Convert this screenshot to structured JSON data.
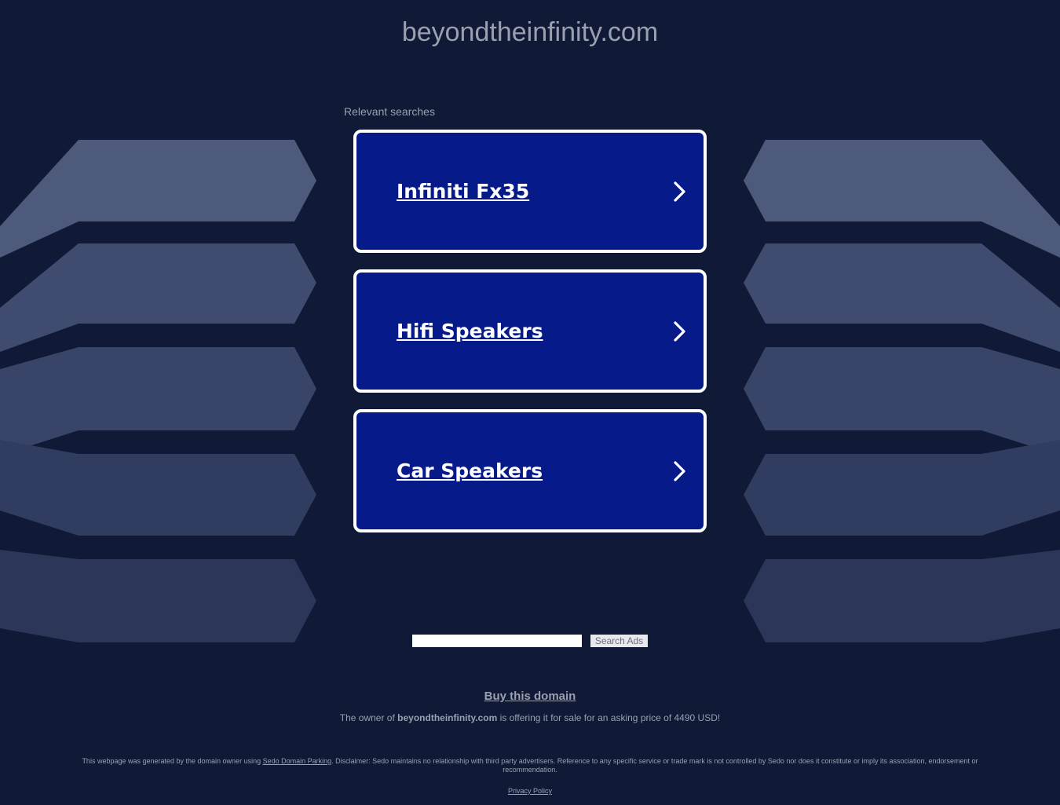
{
  "header": {
    "domain_title": "beyondtheinfinity.com"
  },
  "related": {
    "label": "Relevant searches",
    "items": [
      {
        "label": "Infiniti Fx35"
      },
      {
        "label": "Hifi Speakers"
      },
      {
        "label": "Car Speakers"
      }
    ]
  },
  "search": {
    "value": "",
    "button_label": "Search Ads"
  },
  "sale": {
    "buy_link": "Buy this domain",
    "offer_prefix": "The owner of ",
    "offer_domain": "beyondtheinfinity.com",
    "offer_suffix": " is offering it for sale for an asking price of 4490 USD!"
  },
  "footer": {
    "disclaimer_prefix": "This webpage was generated by the domain owner using ",
    "sedo_link": "Sedo Domain Parking",
    "disclaimer_suffix": ". Disclaimer: Sedo maintains no relationship with third party advertisers. Reference to any specific service or trade mark is not controlled by Sedo nor does it constitute or imply its association, endorsement or recommendation.",
    "privacy_link": "Privacy Policy"
  },
  "colors": {
    "background": "#101935",
    "card_fill": "#061a8a",
    "card_border": "#ffffff",
    "muted_text": "#9aa0b0"
  },
  "icons": {
    "result_arrow": "chevron-right-icon"
  }
}
